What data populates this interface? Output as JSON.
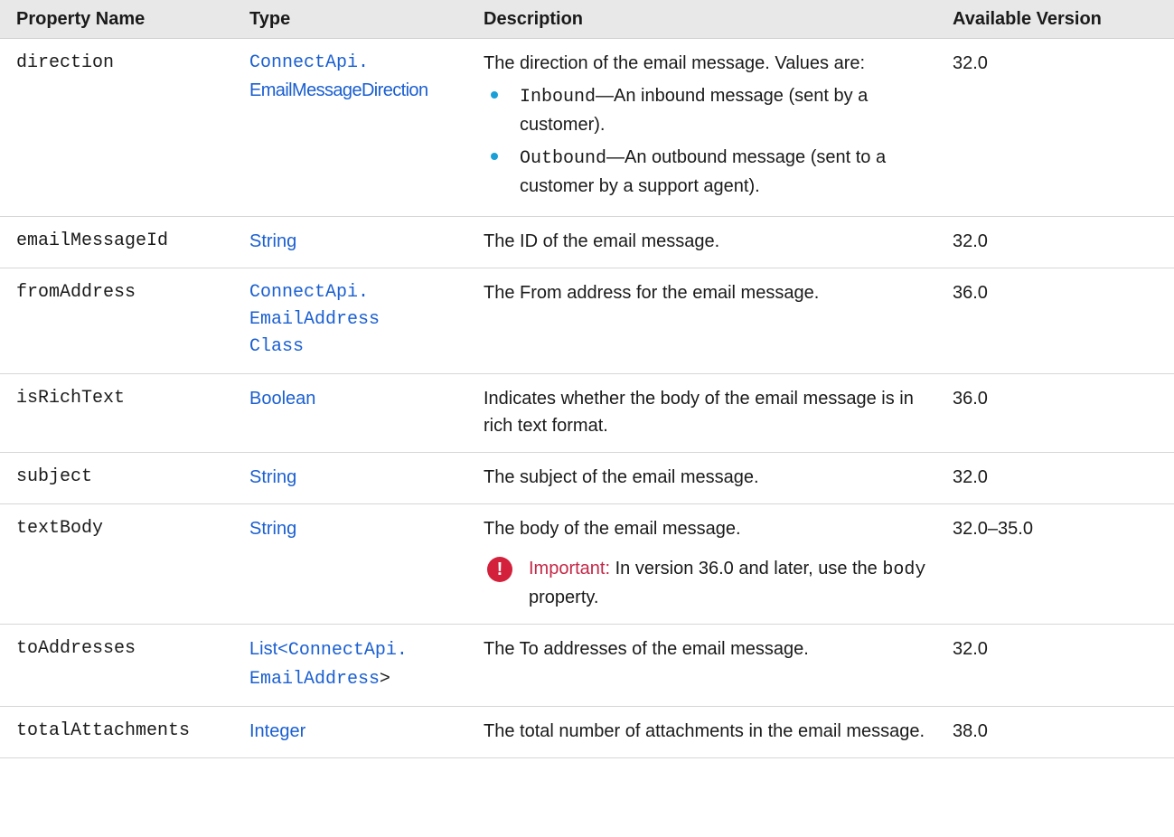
{
  "headers": {
    "property_name": "Property Name",
    "type": "Type",
    "description": "Description",
    "available_version": "Available Version"
  },
  "rows": [
    {
      "name": "direction",
      "type_line1": "ConnectApi.",
      "type_line2": "EmailMessageDirection",
      "description": "The direction of the email message. Values are:",
      "values": [
        {
          "code": "Inbound",
          "text": "—An inbound message (sent by a customer)."
        },
        {
          "code": "Outbound",
          "text": "—An outbound message (sent to a customer by a support agent)."
        }
      ],
      "version": "32.0"
    },
    {
      "name": "emailMessageId",
      "type": "String",
      "description": "The ID of the email message.",
      "version": "32.0"
    },
    {
      "name": "fromAddress",
      "type_line1": "ConnectApi.",
      "type_line2": "EmailAddress",
      "type_line3": "Class",
      "description": "The From address for the email message.",
      "version": "36.0"
    },
    {
      "name": "isRichText",
      "type": "Boolean",
      "description": "Indicates whether the body of the email message is in rich text format.",
      "version": "36.0"
    },
    {
      "name": "subject",
      "type": "String",
      "description": "The subject of the email message.",
      "version": "32.0"
    },
    {
      "name": "textBody",
      "type": "String",
      "description": "The body of the email message.",
      "note_label": "Important:",
      "note_text": "In version 36.0 and later, use the",
      "note_code": "body",
      "note_suffix": "property.",
      "version": "32.0–35.0"
    },
    {
      "name": "toAddresses",
      "type_prefix": "List<",
      "type_line1": "ConnectApi.",
      "type_line2": "EmailAddress",
      "type_suffix": ">",
      "description": "The To addresses of the email message.",
      "version": "32.0"
    },
    {
      "name": "totalAttachments",
      "type": "Integer",
      "description": "The total number of attachments in the email message.",
      "version": "38.0"
    }
  ],
  "icons": {
    "important_icon": "!"
  },
  "colors": {
    "link": "#1a5fd1",
    "header_bg": "#e8e8e8",
    "important": "#c42847",
    "bullet": "#1a9fd6"
  }
}
